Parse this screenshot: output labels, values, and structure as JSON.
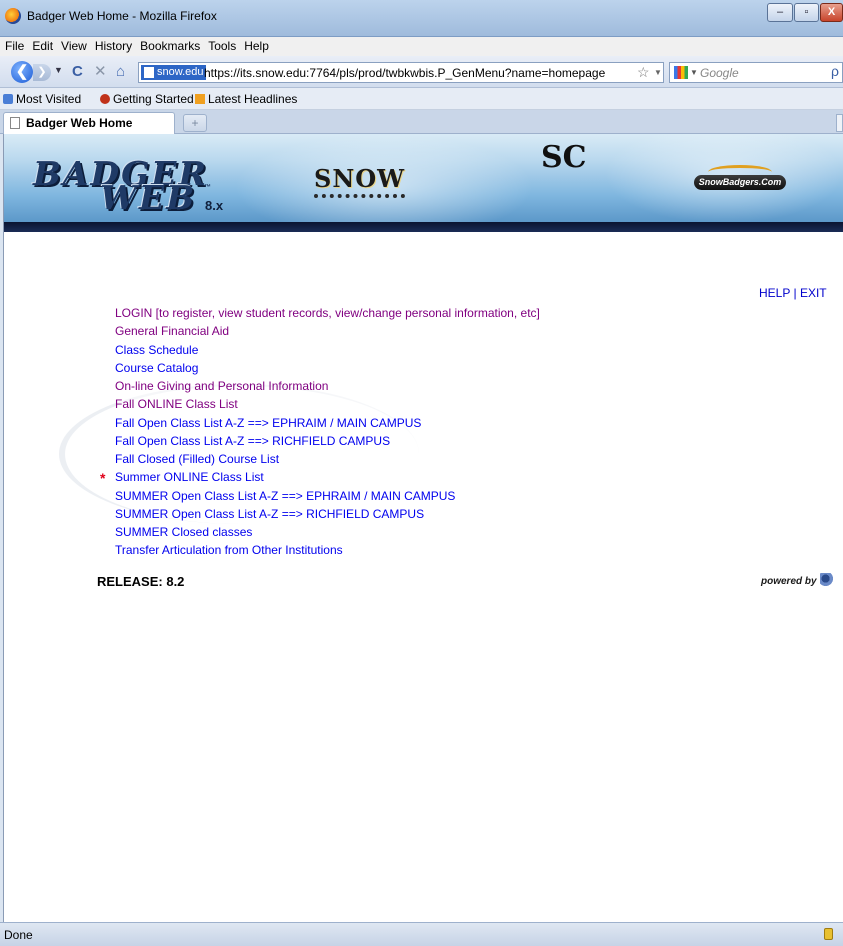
{
  "window": {
    "title": "Badger Web Home - Mozilla Firefox",
    "min_glyph": "–",
    "max_glyph": "▫",
    "close_glyph": "X"
  },
  "menubar": [
    "File",
    "Edit",
    "View",
    "History",
    "Bookmarks",
    "Tools",
    "Help"
  ],
  "nav": {
    "site_identity": "snow.edu",
    "url": "https://its.snow.edu:7764/pls/prod/twbkwbis.P_GenMenu?name=homepage",
    "search_placeholder": "Google",
    "back_glyph": "❮",
    "forward_glyph": "❯",
    "reload_glyph": "C",
    "stop_glyph": "✕",
    "home_glyph": "⌂",
    "star_glyph": "☆",
    "search_glyph": "ρ"
  },
  "bookmarks": [
    "Most Visited",
    "Getting Started",
    "Latest Headlines"
  ],
  "tabs": {
    "active_label": "Badger Web Home",
    "new_tab_glyph": "+"
  },
  "banner": {
    "badger": "BADGER",
    "web": "WEB",
    "tm": "™",
    "version": "8.x",
    "snow": "SNOW",
    "sc": "SC",
    "snowbadgers": "SnowBadgers.Com"
  },
  "help": "HELP",
  "separator": "|",
  "exit": "EXIT",
  "menu_items": [
    {
      "label": "LOGIN [to register, view student records, view/change personal information, etc]",
      "visited": true
    },
    {
      "label": "General Financial Aid",
      "visited": true
    },
    {
      "label": "Class Schedule",
      "visited": false
    },
    {
      "label": "Course Catalog",
      "visited": false
    },
    {
      "label": "On-line Giving and Personal Information",
      "visited": true
    },
    {
      "label": "Fall ONLINE Class List",
      "visited": true
    },
    {
      "label": "Fall Open Class List A-Z ==> EPHRAIM / MAIN CAMPUS",
      "visited": false
    },
    {
      "label": "Fall Open Class List A-Z ==> RICHFIELD CAMPUS",
      "visited": false
    },
    {
      "label": "Fall Closed (Filled) Course List",
      "visited": false
    },
    {
      "label": "Summer ONLINE Class List",
      "visited": false
    },
    {
      "label": "SUMMER Open Class List A-Z ==> EPHRAIM / MAIN CAMPUS",
      "visited": false
    },
    {
      "label": "SUMMER Open Class List A-Z ==> RICHFIELD CAMPUS",
      "visited": false
    },
    {
      "label": "SUMMER Closed classes",
      "visited": false
    },
    {
      "label": "Transfer Articulation from Other Institutions",
      "visited": false
    }
  ],
  "new_marker": "*",
  "release": "RELEASE: 8.2",
  "powered_by": "powered by",
  "status": "Done",
  "colors": {
    "link": "#0000ee",
    "visited": "#800080",
    "marker": "#e0001a"
  }
}
